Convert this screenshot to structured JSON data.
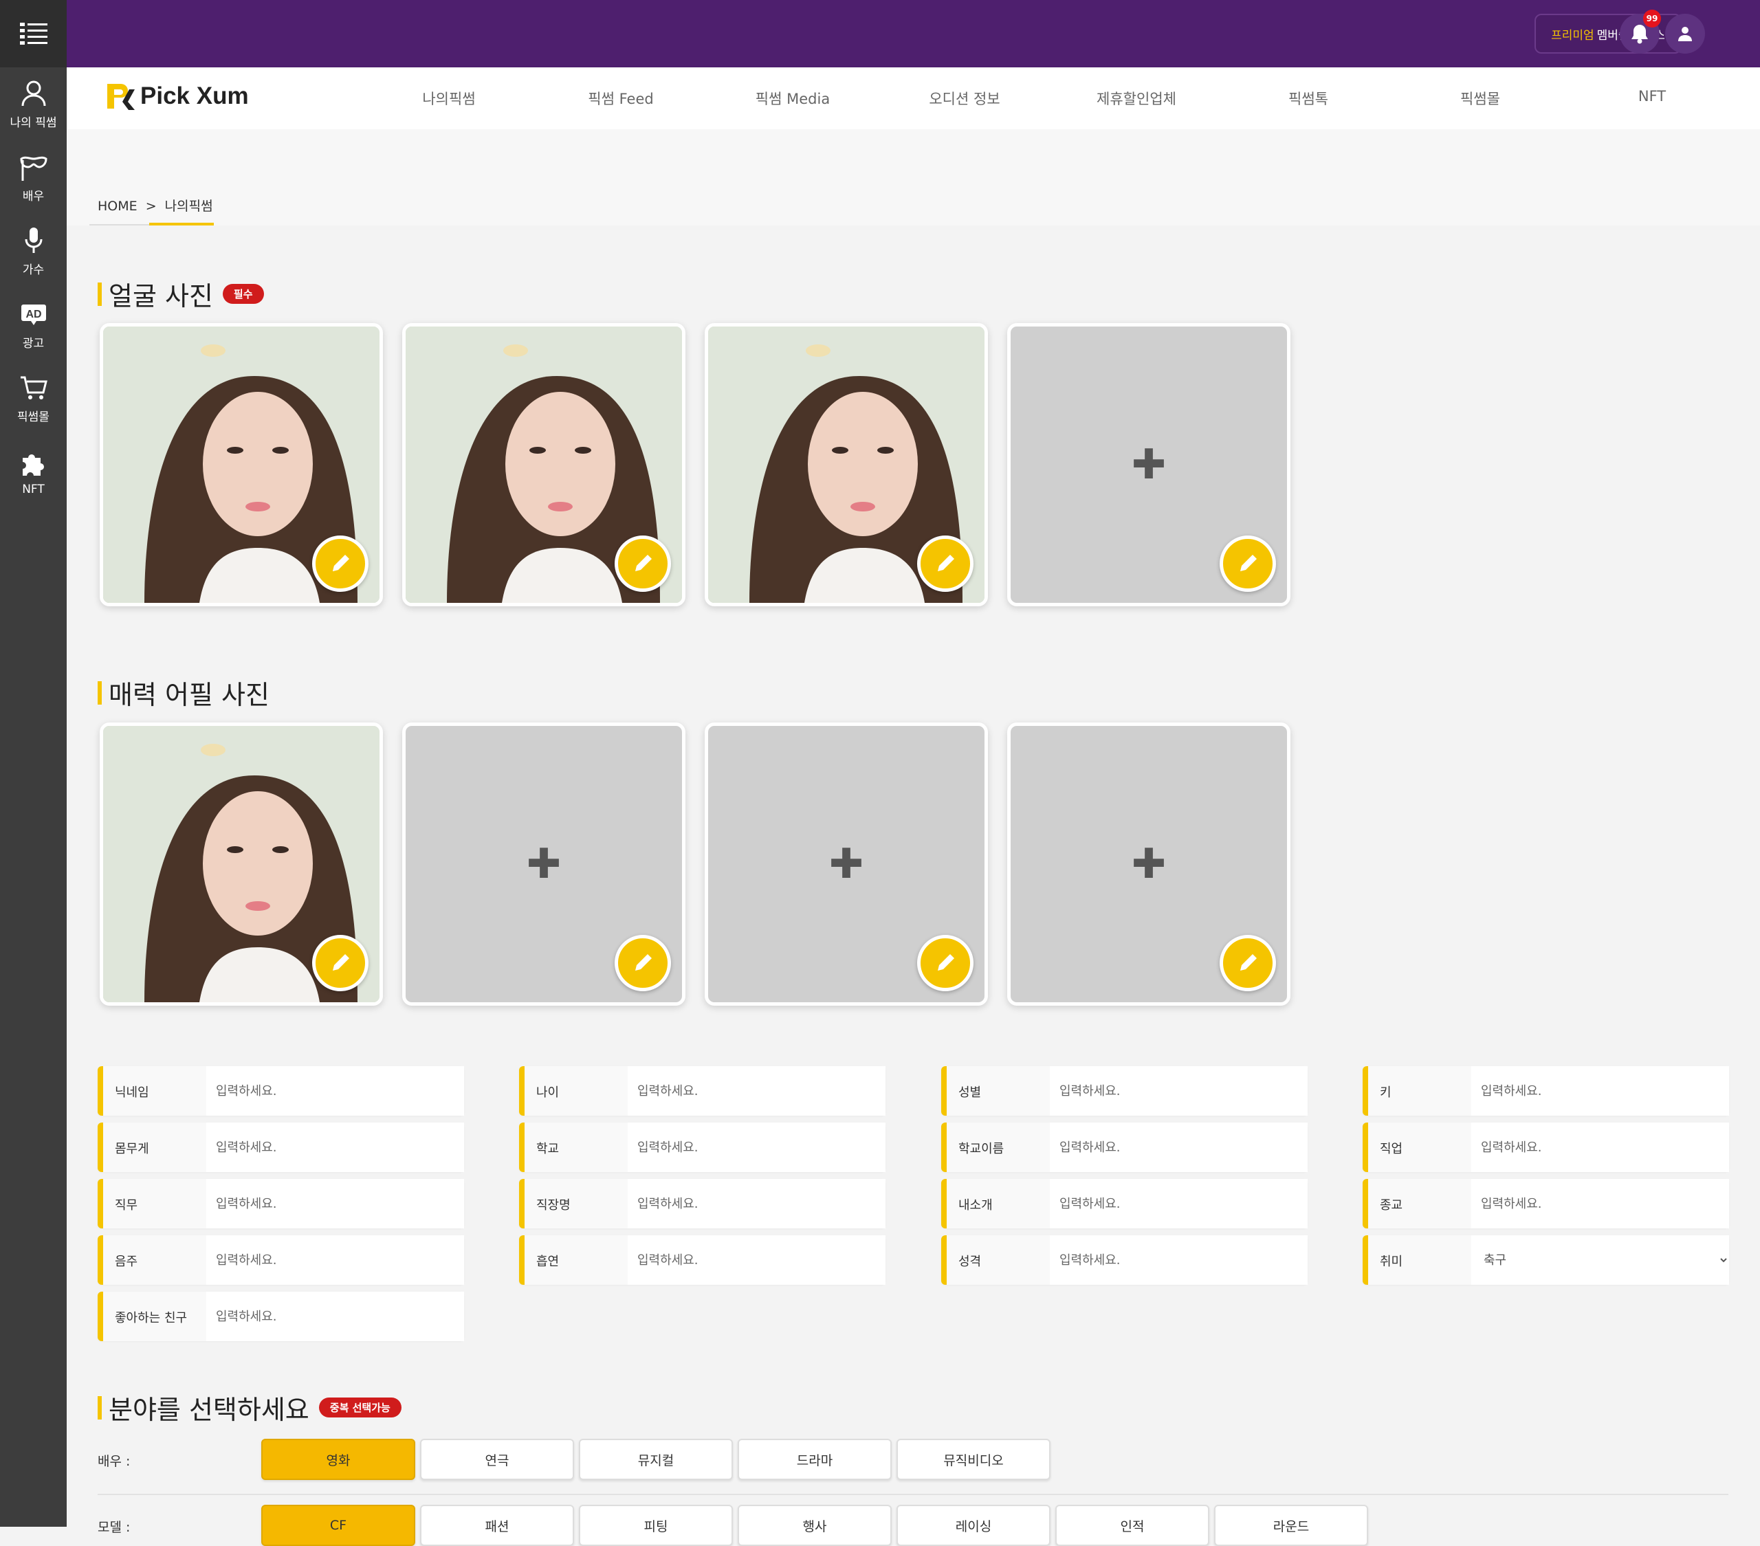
{
  "sidebar": {
    "items": [
      {
        "label": "나의 픽썸",
        "icon": "user-icon"
      },
      {
        "label": "배우",
        "icon": "mask-icon"
      },
      {
        "label": "가수",
        "icon": "microphone-icon"
      },
      {
        "label": "광고",
        "icon": "ad-icon"
      },
      {
        "label": "픽썸몰",
        "icon": "cart-icon"
      },
      {
        "label": "NFT",
        "icon": "puzzle-icon"
      }
    ]
  },
  "topbar": {
    "premium_highlight": "프리미엄",
    "premium_text": "멤버쉽 서비스",
    "notification_count": "99"
  },
  "nav": {
    "logo_text": "Pick Xum",
    "items": [
      "나의픽썸",
      "픽썸 Feed",
      "픽썸 Media",
      "오디션 정보",
      "제휴할인업체",
      "픽썸톡",
      "픽썸몰",
      "NFT"
    ]
  },
  "breadcrumb": {
    "home": "HOME",
    "sep": ">",
    "current": "나의픽썸"
  },
  "face_section": {
    "title": "얼굴 사진",
    "badge": "필수"
  },
  "appeal_section": {
    "title": "매력 어필 사진"
  },
  "fields": {
    "placeholder": "입력하세요.",
    "items": [
      {
        "label": "닉네임"
      },
      {
        "label": "나이"
      },
      {
        "label": "성별"
      },
      {
        "label": "키"
      },
      {
        "label": "몸무게"
      },
      {
        "label": "학교"
      },
      {
        "label": "학교이름"
      },
      {
        "label": "직업"
      },
      {
        "label": "직무"
      },
      {
        "label": "직장명"
      },
      {
        "label": "내소개"
      },
      {
        "label": "종교"
      },
      {
        "label": "음주"
      },
      {
        "label": "흡연"
      },
      {
        "label": "성격"
      },
      {
        "label": "취미",
        "value": "축구"
      },
      {
        "label": "좋아하는 친구"
      }
    ]
  },
  "category_section": {
    "title": "분야를 선택하세요",
    "badge": "중복 선택가능"
  },
  "categories": {
    "actor": {
      "label": "배우 :",
      "options": [
        "영화",
        "연극",
        "뮤지컬",
        "드라마",
        "뮤직비디오"
      ],
      "selected": "영화"
    },
    "model": {
      "label": "모델 :",
      "options": [
        "CF",
        "패션",
        "피팅",
        "행사",
        "레이싱",
        "인적",
        "라운드"
      ],
      "selected": "CF"
    }
  },
  "colors": {
    "accent": "#f5c400",
    "header": "#4e1f6e",
    "sidebar": "#3d3d3d",
    "badge": "#d01c1c"
  }
}
